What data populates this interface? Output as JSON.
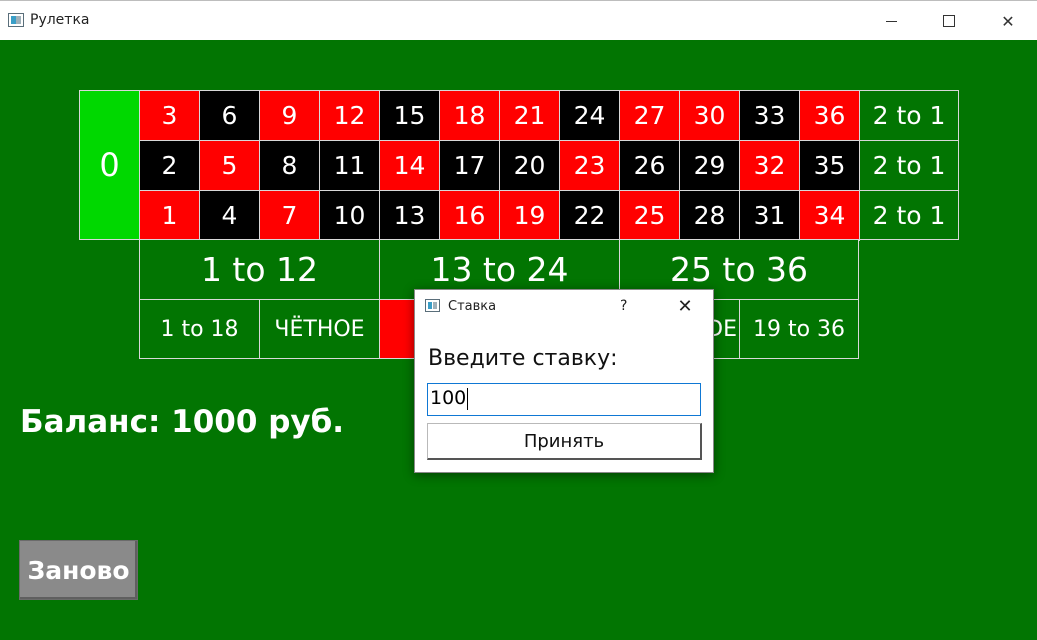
{
  "window": {
    "title": "Рулетка",
    "min_label": "",
    "close_label": "✕"
  },
  "colors": {
    "felt": "#027502",
    "red": "#ff0000",
    "black": "#000000",
    "zero": "#00d800"
  },
  "board": {
    "zero": "0",
    "rows": [
      [
        {
          "n": "3",
          "c": "red"
        },
        {
          "n": "6",
          "c": "black"
        },
        {
          "n": "9",
          "c": "red"
        },
        {
          "n": "12",
          "c": "red"
        },
        {
          "n": "15",
          "c": "black"
        },
        {
          "n": "18",
          "c": "red"
        },
        {
          "n": "21",
          "c": "red"
        },
        {
          "n": "24",
          "c": "black"
        },
        {
          "n": "27",
          "c": "red"
        },
        {
          "n": "30",
          "c": "red"
        },
        {
          "n": "33",
          "c": "black"
        },
        {
          "n": "36",
          "c": "red"
        }
      ],
      [
        {
          "n": "2",
          "c": "black"
        },
        {
          "n": "5",
          "c": "red"
        },
        {
          "n": "8",
          "c": "black"
        },
        {
          "n": "11",
          "c": "black"
        },
        {
          "n": "14",
          "c": "red"
        },
        {
          "n": "17",
          "c": "black"
        },
        {
          "n": "20",
          "c": "black"
        },
        {
          "n": "23",
          "c": "red"
        },
        {
          "n": "26",
          "c": "black"
        },
        {
          "n": "29",
          "c": "black"
        },
        {
          "n": "32",
          "c": "red"
        },
        {
          "n": "35",
          "c": "black"
        }
      ],
      [
        {
          "n": "1",
          "c": "red"
        },
        {
          "n": "4",
          "c": "black"
        },
        {
          "n": "7",
          "c": "red"
        },
        {
          "n": "10",
          "c": "black"
        },
        {
          "n": "13",
          "c": "black"
        },
        {
          "n": "16",
          "c": "red"
        },
        {
          "n": "19",
          "c": "red"
        },
        {
          "n": "22",
          "c": "black"
        },
        {
          "n": "25",
          "c": "red"
        },
        {
          "n": "28",
          "c": "black"
        },
        {
          "n": "31",
          "c": "black"
        },
        {
          "n": "34",
          "c": "red"
        }
      ]
    ],
    "column_bets": [
      "2 to 1",
      "2 to 1",
      "2 to 1"
    ],
    "dozens": [
      "1 to 12",
      "13 to 24",
      "25 to 36"
    ],
    "outside": [
      {
        "label": "1 to 18",
        "bg": "#027502"
      },
      {
        "label": "ЧЁТНОЕ",
        "bg": "#027502"
      },
      {
        "label": "",
        "bg": "#ff0000"
      },
      {
        "label": "",
        "bg": "#000000"
      },
      {
        "label": "DE",
        "bg": "#027502"
      },
      {
        "label": "19 to 36",
        "bg": "#027502"
      }
    ]
  },
  "balance": "Баланс: 1000 руб.",
  "restart_label": "Заново",
  "dialog": {
    "title": "Ставка",
    "help": "?",
    "close": "✕",
    "prompt": "Введите ставку:",
    "value": "100",
    "accept_label": "Принять"
  }
}
